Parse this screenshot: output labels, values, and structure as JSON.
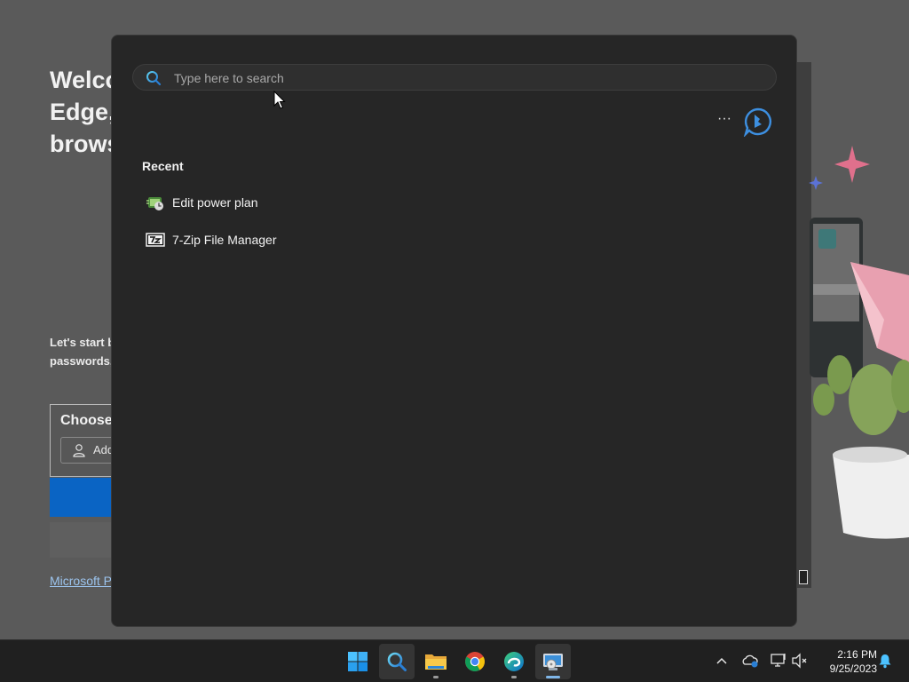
{
  "background_window": {
    "welcome_lines": [
      "Welcome to Microsoft",
      "Edge,",
      "browser"
    ],
    "desc_lines": [
      "Let's start by",
      "passwords,"
    ],
    "card_title": "Choose",
    "card_input": "Add",
    "link": "Microsoft Privacy"
  },
  "search": {
    "placeholder": "Type here to search",
    "more_label": "···",
    "recent_heading": "Recent",
    "recent_items": [
      {
        "label": "Edit power plan",
        "icon": "power-plan-icon"
      },
      {
        "label": "7-Zip File Manager",
        "icon": "7zip-icon"
      }
    ]
  },
  "taskbar": {
    "apps": [
      {
        "name": "start",
        "icon": "windows-logo-icon"
      },
      {
        "name": "search",
        "icon": "search-icon",
        "active": true
      },
      {
        "name": "file-explorer",
        "icon": "folder-icon"
      },
      {
        "name": "chrome",
        "icon": "chrome-icon"
      },
      {
        "name": "edge",
        "icon": "edge-icon"
      },
      {
        "name": "installer",
        "icon": "installer-icon"
      }
    ],
    "tray": {
      "time": "2:16 PM",
      "date": "9/25/2023"
    }
  },
  "colors": {
    "panel_bg": "#262626",
    "accent": "#4aa3e8",
    "taskbar_bg": "#202020"
  }
}
